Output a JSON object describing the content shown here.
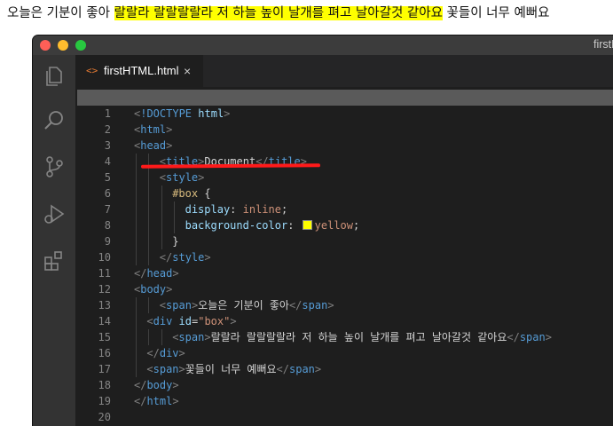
{
  "rendered_output": {
    "text1": "오늘은 기분이 좋아 ",
    "highlight": "랄랄라 랄랄랄랄라 저 하늘 높이 날개를 펴고 날아갈것 같아요",
    "text2": " 꽃들이 너무 예뻐요"
  },
  "window": {
    "title": "firstHTML.html"
  },
  "tab": {
    "icon": "<>",
    "label": "firstHTML.html",
    "close": "×"
  },
  "activity_bar": [
    "explorer-icon",
    "search-icon",
    "source-control-icon",
    "run-debug-icon",
    "extensions-icon"
  ],
  "code_lines": [
    {
      "n": "1",
      "indent": 0,
      "tokens": [
        [
          "br",
          "<"
        ],
        [
          "tag",
          "!DOCTYPE"
        ],
        [
          "text",
          " "
        ],
        [
          "attr",
          "html"
        ],
        [
          "br",
          ">"
        ]
      ]
    },
    {
      "n": "2",
      "indent": 0,
      "tokens": [
        [
          "br",
          "<"
        ],
        [
          "tag",
          "html"
        ],
        [
          "br",
          ">"
        ]
      ]
    },
    {
      "n": "3",
      "indent": 0,
      "tokens": [
        [
          "br",
          "<"
        ],
        [
          "tag",
          "head"
        ],
        [
          "br",
          ">"
        ]
      ]
    },
    {
      "n": "4",
      "indent": 2,
      "tokens": [
        [
          "br",
          "<"
        ],
        [
          "tag",
          "title"
        ],
        [
          "br",
          ">"
        ],
        [
          "text",
          "Document"
        ],
        [
          "br",
          "</"
        ],
        [
          "tag",
          "title"
        ],
        [
          "br",
          ">"
        ]
      ]
    },
    {
      "n": "5",
      "indent": 2,
      "tokens": [
        [
          "br",
          "<"
        ],
        [
          "tag",
          "style"
        ],
        [
          "br",
          ">"
        ]
      ]
    },
    {
      "n": "6",
      "indent": 3,
      "tokens": [
        [
          "sel",
          "#box"
        ],
        [
          "text",
          " {"
        ]
      ]
    },
    {
      "n": "7",
      "indent": 4,
      "tokens": [
        [
          "prop",
          "display"
        ],
        [
          "text",
          ": "
        ],
        [
          "val",
          "inline"
        ],
        [
          "text",
          ";"
        ]
      ]
    },
    {
      "n": "8",
      "indent": 4,
      "tokens": [
        [
          "prop",
          "background-color"
        ],
        [
          "text",
          ": "
        ],
        [
          "swatch",
          ""
        ],
        [
          "val",
          "yellow"
        ],
        [
          "text",
          ";"
        ]
      ]
    },
    {
      "n": "9",
      "indent": 3,
      "tokens": [
        [
          "text",
          "}"
        ]
      ]
    },
    {
      "n": "10",
      "indent": 2,
      "tokens": [
        [
          "br",
          "</"
        ],
        [
          "tag",
          "style"
        ],
        [
          "br",
          ">"
        ]
      ]
    },
    {
      "n": "11",
      "indent": 0,
      "tokens": [
        [
          "br",
          "</"
        ],
        [
          "tag",
          "head"
        ],
        [
          "br",
          ">"
        ]
      ]
    },
    {
      "n": "12",
      "indent": 0,
      "tokens": [
        [
          "br",
          "<"
        ],
        [
          "tag",
          "body"
        ],
        [
          "br",
          ">"
        ]
      ]
    },
    {
      "n": "13",
      "indent": 2,
      "tokens": [
        [
          "br",
          "<"
        ],
        [
          "tag",
          "span"
        ],
        [
          "br",
          ">"
        ],
        [
          "text",
          "오늘은 기분이 좋아"
        ],
        [
          "br",
          "</"
        ],
        [
          "tag",
          "span"
        ],
        [
          "br",
          ">"
        ]
      ]
    },
    {
      "n": "14",
      "indent": 1,
      "tokens": [
        [
          "br",
          "<"
        ],
        [
          "tag",
          "div"
        ],
        [
          "text",
          " "
        ],
        [
          "attr",
          "id"
        ],
        [
          "text",
          "="
        ],
        [
          "str",
          "\"box\""
        ],
        [
          "br",
          ">"
        ]
      ]
    },
    {
      "n": "15",
      "indent": 3,
      "tokens": [
        [
          "br",
          "<"
        ],
        [
          "tag",
          "span"
        ],
        [
          "br",
          ">"
        ],
        [
          "text",
          "랄랄라 랄랄랄랄라 저 하늘 높이 날개를 펴고 날아갈것 같아요"
        ],
        [
          "br",
          "</"
        ],
        [
          "tag",
          "span"
        ],
        [
          "br",
          ">"
        ]
      ]
    },
    {
      "n": "16",
      "indent": 1,
      "tokens": [
        [
          "br",
          "</"
        ],
        [
          "tag",
          "div"
        ],
        [
          "br",
          ">"
        ]
      ]
    },
    {
      "n": "17",
      "indent": 1,
      "tokens": [
        [
          "br",
          "<"
        ],
        [
          "tag",
          "span"
        ],
        [
          "br",
          ">"
        ],
        [
          "text",
          "꽃들이 너무 예뻐요"
        ],
        [
          "br",
          "</"
        ],
        [
          "tag",
          "span"
        ],
        [
          "br",
          ">"
        ]
      ]
    },
    {
      "n": "18",
      "indent": 0,
      "tokens": [
        [
          "br",
          "</"
        ],
        [
          "tag",
          "body"
        ],
        [
          "br",
          ">"
        ]
      ]
    },
    {
      "n": "19",
      "indent": 0,
      "tokens": [
        [
          "br",
          "</"
        ],
        [
          "tag",
          "html"
        ],
        [
          "br",
          ">"
        ]
      ]
    },
    {
      "n": "20",
      "indent": 0,
      "tokens": []
    }
  ],
  "colors": {
    "highlight": "#ffff00",
    "annotation_underline": "#ff1a1a"
  }
}
